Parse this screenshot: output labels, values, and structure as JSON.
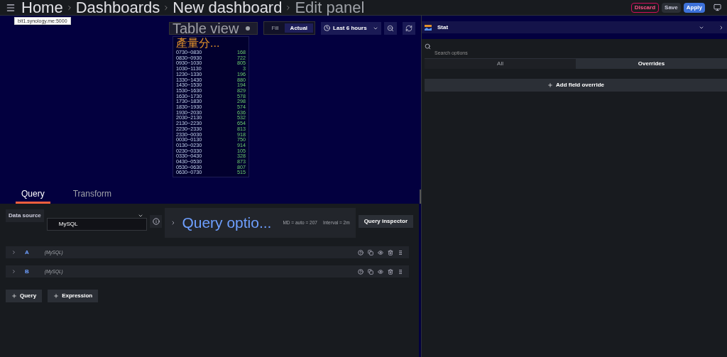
{
  "breadcrumbs": [
    {
      "label": "Home"
    },
    {
      "label": "Dashboards"
    },
    {
      "label": "New dashboard"
    },
    {
      "label": "Edit panel"
    }
  ],
  "tooltip": {
    "url": "blt1.synology.me:5000"
  },
  "actions": [
    {
      "label": "Discard",
      "kind": "danger"
    },
    {
      "label": "Save",
      "kind": "secondary"
    },
    {
      "label": "Apply",
      "kind": "primary"
    }
  ],
  "panel_toolbar": {
    "table_view": {
      "label": "Table view",
      "on": false
    },
    "size_modes": [
      {
        "label": "Fill",
        "selected": false
      },
      {
        "label": "Actual",
        "selected": true
      }
    ],
    "time_range": "Last 6 hours"
  },
  "panel": {
    "title": "產量分...",
    "rows": [
      {
        "time": "0730~0830",
        "value": "168"
      },
      {
        "time": "0830~0930",
        "value": "722"
      },
      {
        "time": "0930~1030",
        "value": "805"
      },
      {
        "time": "1030~1130",
        "value": "3"
      },
      {
        "time": "1230~1330",
        "value": "196"
      },
      {
        "time": "1330~1430",
        "value": "880"
      },
      {
        "time": "1430~1530",
        "value": "194"
      },
      {
        "time": "1530~1630",
        "value": "829"
      },
      {
        "time": "1630~1730",
        "value": "578"
      },
      {
        "time": "1730~1830",
        "value": "298"
      },
      {
        "time": "1830~1930",
        "value": "574"
      },
      {
        "time": "1930~2030",
        "value": "636"
      },
      {
        "time": "2030~2130",
        "value": "532"
      },
      {
        "time": "2130~2230",
        "value": "654"
      },
      {
        "time": "2230~2330",
        "value": "813"
      },
      {
        "time": "2330~0030",
        "value": "918"
      },
      {
        "time": "0030~0130",
        "value": "750"
      },
      {
        "time": "0130~0230",
        "value": "914"
      },
      {
        "time": "0230~0330",
        "value": "105"
      },
      {
        "time": "0330~0430",
        "value": "328"
      },
      {
        "time": "0430~0530",
        "value": "873"
      },
      {
        "time": "0530~0630",
        "value": "807"
      },
      {
        "time": "0630~0730",
        "value": "515"
      }
    ]
  },
  "editor_tabs": [
    {
      "label": "Query",
      "selected": true
    },
    {
      "label": "Transform",
      "selected": false
    }
  ],
  "data_source": {
    "label": "Data source",
    "value": "MySQL"
  },
  "query_options": {
    "title": "Query optio...",
    "md": "MD = auto = 207",
    "interval": "Interval = 2m"
  },
  "query_inspector": "Query inspector",
  "queries": [
    {
      "ref": "A",
      "source": "(MySQL)"
    },
    {
      "ref": "B",
      "source": "(MySQL)"
    }
  ],
  "add_buttons": [
    {
      "label": "Query"
    },
    {
      "label": "Expression"
    }
  ],
  "options_pane": {
    "visualization": "Stat",
    "search_placeholder": "Search options",
    "tabs": [
      {
        "label": "All",
        "selected": false
      },
      {
        "label": "Overrides",
        "selected": true
      }
    ],
    "add_override": "Add field override"
  }
}
